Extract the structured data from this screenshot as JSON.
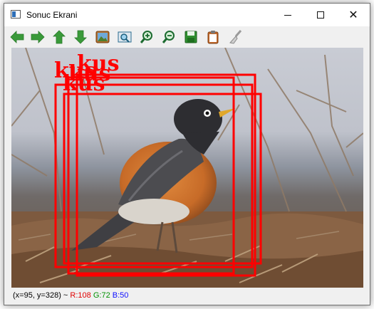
{
  "window": {
    "title": "Sonuc Ekrani",
    "controls": {
      "minimize": "minimize",
      "maximize": "maximize",
      "close": "✕"
    }
  },
  "toolbar": {
    "buttons": [
      {
        "icon": "arrow-left-icon",
        "name": "pan-left-button"
      },
      {
        "icon": "arrow-right-icon",
        "name": "pan-right-button"
      },
      {
        "icon": "arrow-up-icon",
        "name": "pan-up-button"
      },
      {
        "icon": "arrow-down-icon",
        "name": "pan-down-button"
      },
      {
        "icon": "image-icon",
        "name": "fit-image-button"
      },
      {
        "icon": "zoom-region-icon",
        "name": "zoom-region-button"
      },
      {
        "icon": "zoom-in-icon",
        "name": "zoom-in-button"
      },
      {
        "icon": "zoom-out-icon",
        "name": "zoom-out-button"
      },
      {
        "icon": "save-icon",
        "name": "save-button"
      },
      {
        "icon": "clipboard-icon",
        "name": "copy-button"
      },
      {
        "icon": "brush-icon",
        "name": "properties-button"
      }
    ]
  },
  "image": {
    "detections": [
      {
        "label": "kus"
      },
      {
        "label": "kus"
      },
      {
        "label": "kus"
      },
      {
        "label": "kus"
      }
    ],
    "box_color": "#ff0000"
  },
  "status": {
    "coords": "(x=95, y=328) ~ ",
    "r": "R:108",
    "g": "G:72",
    "b": "B:50"
  },
  "colors": {
    "arrow_green": "#3a9a3a",
    "save_green": "#2f8f2f",
    "status_r": "#e00000",
    "status_g": "#009000",
    "status_b": "#1010ff"
  }
}
